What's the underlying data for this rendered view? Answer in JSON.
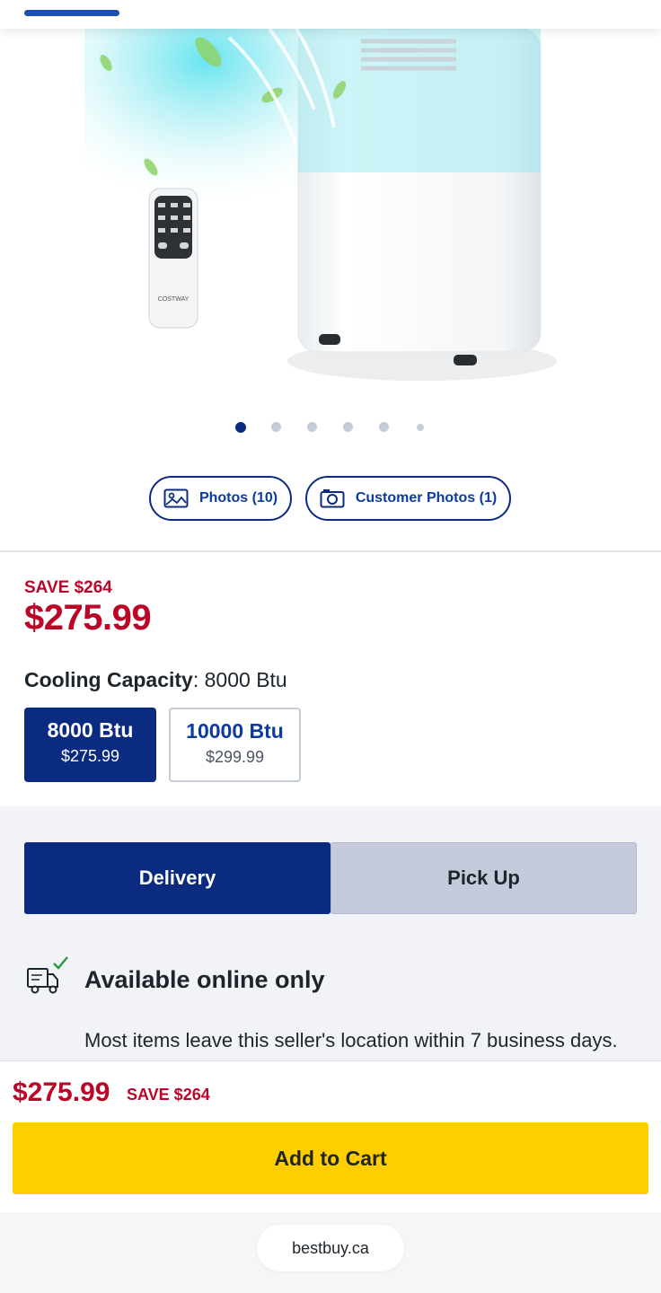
{
  "product": {
    "image_alt": "",
    "remote_brand": "COSTWAY",
    "carousel": {
      "count": 6,
      "active_index": 0
    }
  },
  "media": {
    "photos_label": "Photos (10)",
    "customer_photos_label": "Customer Photos (1)"
  },
  "pricing": {
    "save_label": "SAVE $264",
    "price": "$275.99"
  },
  "capacity": {
    "label": "Cooling Capacity",
    "separator": ":",
    "value": " 8000 Btu",
    "options": [
      {
        "name": "8000 Btu",
        "price": "$275.99",
        "selected": true
      },
      {
        "name": "10000 Btu",
        "price": "$299.99",
        "selected": false
      }
    ]
  },
  "fulfillment": {
    "tabs": [
      "Delivery",
      "Pick Up"
    ],
    "active_tab": "Delivery",
    "availability_title": "Available online only",
    "availability_desc": "Most items leave this seller's location within 7 business days. All additional times for shipping are governed by"
  },
  "sticky_bar": {
    "price": "$275.99",
    "save_label": "SAVE $264",
    "add_to_cart_label": "Add to Cart"
  },
  "browser": {
    "url": "bestbuy.ca"
  },
  "colors": {
    "brand_blue": "#0b2b80",
    "sale_red": "#bb0628",
    "cta_yellow": "#ffce00"
  }
}
